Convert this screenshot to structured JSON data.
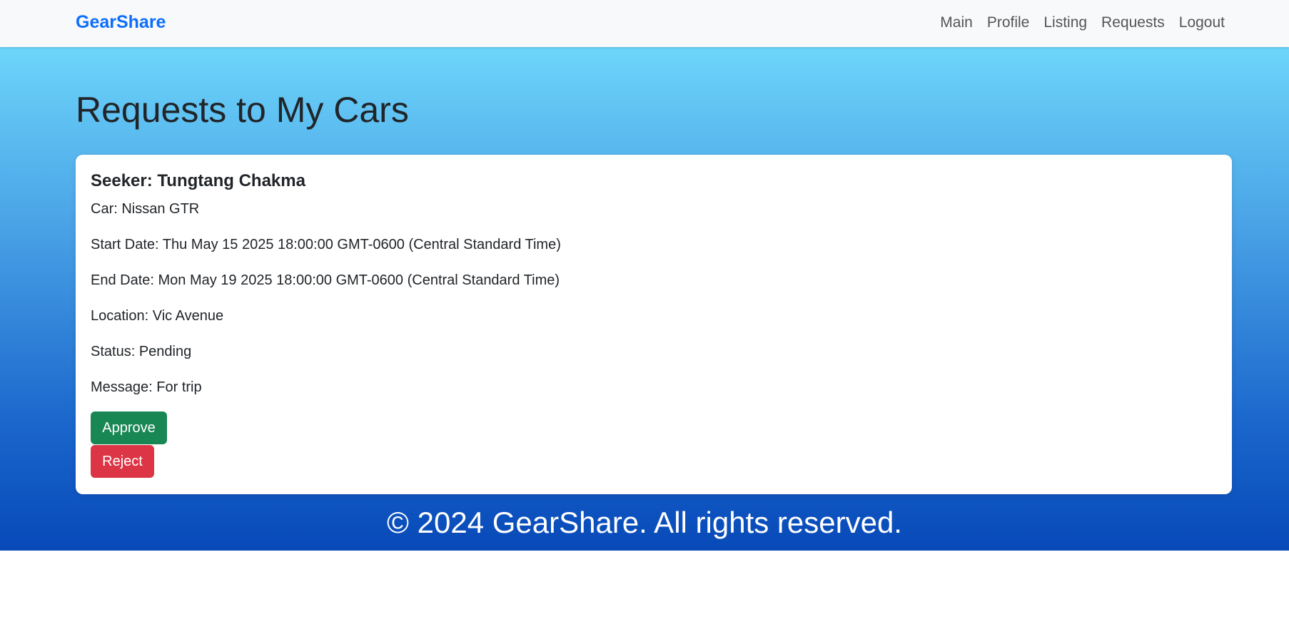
{
  "nav": {
    "brand": "GearShare",
    "links": [
      "Main",
      "Profile",
      "Listing",
      "Requests",
      "Logout"
    ]
  },
  "page": {
    "title": "Requests to My Cars"
  },
  "request": {
    "seeker": "Seeker: Tungtang Chakma",
    "car": "Car: Nissan GTR",
    "start_date": "Start Date: Thu May 15 2025 18:00:00 GMT-0600 (Central Standard Time)",
    "end_date": "End Date: Mon May 19 2025 18:00:00 GMT-0600 (Central Standard Time)",
    "location": "Location: Vic Avenue",
    "status": "Status: Pending",
    "message": "Message: For trip",
    "approve_label": "Approve",
    "reject_label": "Reject"
  },
  "footer": {
    "text": "© 2024 GearShare. All rights reserved."
  },
  "colors": {
    "brand": "#0d6efd",
    "approve": "#198754",
    "reject": "#dc3545"
  }
}
